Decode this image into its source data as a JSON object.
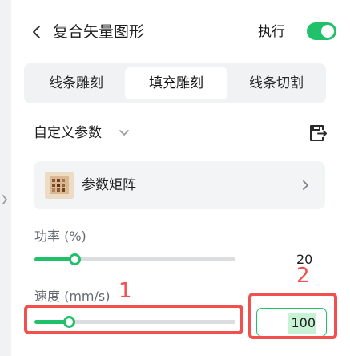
{
  "header": {
    "title": "复合矢量图形",
    "execute_label": "执行",
    "execute_enabled": true
  },
  "tabs": [
    {
      "label": "线条雕刻",
      "active": false
    },
    {
      "label": "填充雕刻",
      "active": true
    },
    {
      "label": "线条切割",
      "active": false
    }
  ],
  "custom_params": {
    "label": "自定义参数"
  },
  "param_matrix": {
    "label": "参数矩阵"
  },
  "power": {
    "label": "功率 (%)",
    "value": "20",
    "slider_fraction": 0.2
  },
  "speed": {
    "label": "速度 (mm/s)",
    "value": "100",
    "slider_fraction": 0.17
  },
  "annotations": {
    "first": "1",
    "second": "2"
  },
  "colors": {
    "accent": "#21c16b",
    "annotation": "#f0514e"
  },
  "icons": [
    "chevron-left-icon",
    "chevron-down-icon",
    "export-icon",
    "chevron-right-icon",
    "collapse-handle-icon"
  ]
}
